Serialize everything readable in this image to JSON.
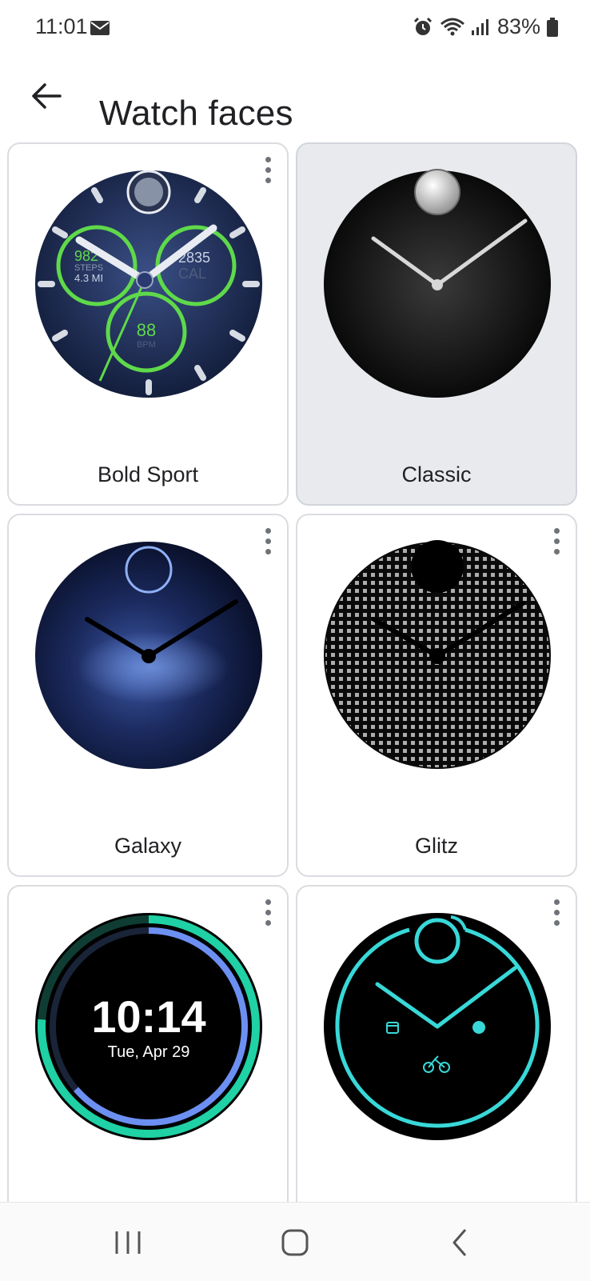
{
  "status_bar": {
    "time": "11:01",
    "battery": "83%",
    "icons": [
      "mail-icon",
      "alarm-icon",
      "wifi-icon",
      "signal-icon",
      "battery-icon"
    ]
  },
  "app_bar": {
    "title": "Watch faces",
    "back_icon": "arrow-back-icon"
  },
  "watch_faces": [
    {
      "name": "Bold Sport",
      "selected": false,
      "complications": {
        "steps": "982",
        "steps_label": "STEPS",
        "distance": "4.3 MI",
        "calories": "2835",
        "calories_label": "CAL",
        "heart_rate": "88",
        "heart_rate_label": "BPM"
      }
    },
    {
      "name": "Classic",
      "selected": true
    },
    {
      "name": "Galaxy",
      "selected": false
    },
    {
      "name": "Glitz",
      "selected": false
    },
    {
      "name": "",
      "selected": false,
      "time": "10:14",
      "date": "Tue, Apr 29"
    },
    {
      "name": "",
      "selected": false
    }
  ],
  "colors": {
    "accent_green": "#5fd94a",
    "ring_teal": "#1fd1a5",
    "ring_blue": "#6c8ff2",
    "neon_cyan": "#39d8d8",
    "selected_card_bg": "#e8eaed"
  },
  "nav_bar": {
    "recents_icon": "recents-icon",
    "home_icon": "home-icon",
    "back_icon": "nav-back-icon"
  }
}
